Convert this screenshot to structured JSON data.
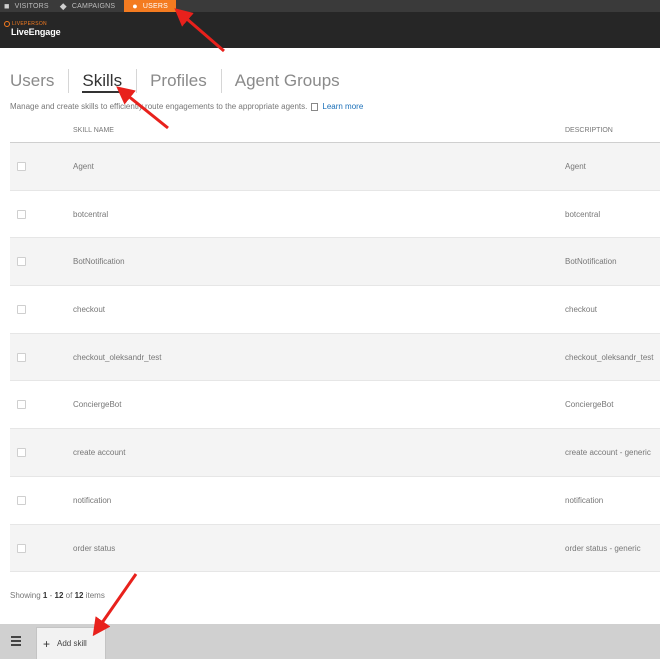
{
  "topnav": {
    "items": [
      {
        "label": "VISITORS",
        "icon": "chat-bubble-icon"
      },
      {
        "label": "CAMPAIGNS",
        "icon": "tag-icon"
      },
      {
        "label": "USERS",
        "icon": "user-icon"
      }
    ],
    "active_color": "#f47b20"
  },
  "brand": {
    "small": "LIVEPERSON",
    "name": "LiveEngage"
  },
  "tabs": [
    {
      "label": "Users"
    },
    {
      "label": "Skills"
    },
    {
      "label": "Profiles"
    },
    {
      "label": "Agent Groups"
    }
  ],
  "description": {
    "text": "Manage and create skills to efficiently route engagements to the appropriate agents.",
    "learn_more": "Learn more"
  },
  "table": {
    "headers": {
      "name": "SKILL NAME",
      "description": "DESCRIPTION"
    },
    "rows": [
      {
        "name": "Agent",
        "description": "Agent"
      },
      {
        "name": "botcentral",
        "description": "botcentral"
      },
      {
        "name": "BotNotification",
        "description": "BotNotification"
      },
      {
        "name": "checkout",
        "description": "checkout"
      },
      {
        "name": "checkout_oleksandr_test",
        "description": "checkout_oleksandr_test"
      },
      {
        "name": "ConciergeBot",
        "description": "ConciergeBot"
      },
      {
        "name": "create account",
        "description": "create account - generic"
      },
      {
        "name": "notification",
        "description": "notification"
      },
      {
        "name": "order status",
        "description": "order status - generic"
      }
    ]
  },
  "pagination": {
    "prefix": "Showing",
    "from": "1",
    "dash": "-",
    "to": "12",
    "of": "of",
    "total": "12",
    "suffix": "items"
  },
  "bottombar": {
    "add_label": "Add skill"
  },
  "annotation_color": "#e8211c"
}
